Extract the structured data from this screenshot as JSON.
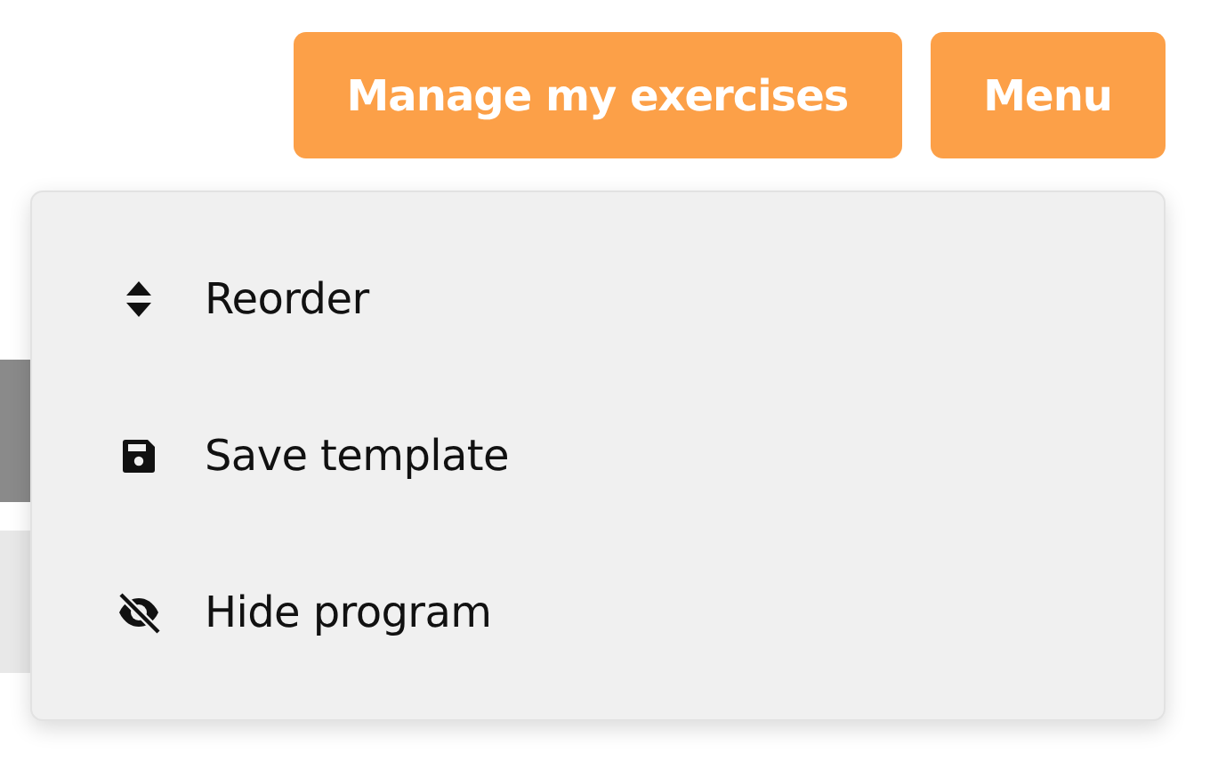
{
  "header_buttons": [
    {
      "label": "Manage my exercises"
    },
    {
      "label": "Menu"
    }
  ],
  "menu": {
    "open": true,
    "items": [
      {
        "label": "Reorder",
        "kind": "sort"
      },
      {
        "label": "Save template",
        "kind": "save"
      },
      {
        "label": "Hide program",
        "kind": "hide"
      }
    ]
  }
}
